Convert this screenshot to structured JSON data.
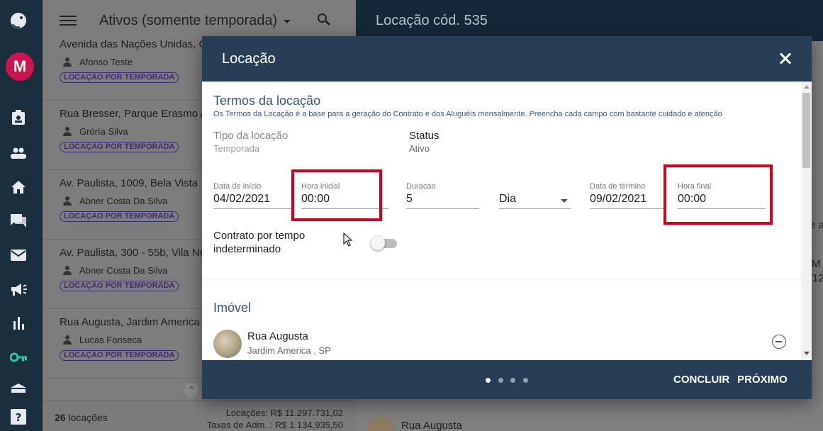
{
  "list": {
    "title": "Ativos (somente temporada)",
    "items": [
      {
        "address": "Avenida das Nações Unidas, C",
        "person": "Afonso Teste",
        "badge": "LOCAÇÃO POR TEMPORADA"
      },
      {
        "address": "Rua Bresser, Parque Erasmo A",
        "person": "Gróría Silva",
        "badge": "LOCAÇÃO POR TEMPORADA"
      },
      {
        "address": "Av. Paulista, 1009, Bela Vista",
        "person": "Abner Costa Da Silva",
        "badge": "LOCAÇÃO POR TEMPORADA"
      },
      {
        "address": "Av. Paulista, 300 - 55b, Vila No",
        "person": "Abner Costa Da Silva",
        "badge": "LOCAÇÃO POR TEMPORADA"
      },
      {
        "address": "Rua Augusta, Jardim America",
        "person": "Lucas Fonseca",
        "badge": "LOCAÇÃO POR TEMPORADA"
      }
    ],
    "footer": {
      "count_number": "26",
      "count_label": "locações",
      "locacoes_label": "Locações:",
      "locacoes_value": "R$ 11.297.731,02",
      "taxas_label": "Taxas de Adm. :",
      "taxas_value": "R$ 1.134.935,50"
    }
  },
  "user": {
    "initial": "M"
  },
  "detail": {
    "title": "Locação cód. 535",
    "peek_address": "Rua Augusta",
    "fragments": {
      "a": "e a",
      "m": "M",
      "date": "/12"
    }
  },
  "modal": {
    "title": "Locação",
    "section_terms": {
      "title": "Termos da locação",
      "description": "Os Termos da Locação é a base para a geração do Contrato e dos Aluguéis mensalmente. Preencha cada campo com bastante cuidado e atenção"
    },
    "tipo": {
      "label": "Tipo da locação",
      "value": "Temporada"
    },
    "status": {
      "label": "Status",
      "value": "Ativo"
    },
    "fields": {
      "data_inicio": {
        "label": "Data de início",
        "value": "04/02/2021"
      },
      "hora_inicial": {
        "label": "Hora inicial",
        "value": "00:00"
      },
      "duracao": {
        "label": "Duracao",
        "value": "5"
      },
      "unidade": {
        "value": "Dia"
      },
      "data_termino": {
        "label": "Data de término",
        "value": "09/02/2021"
      },
      "hora_final": {
        "label": "Hora final",
        "value": "00:00"
      }
    },
    "toggle": {
      "label_line1": "Contrato por tempo",
      "label_line2": "indeterminado",
      "on": false
    },
    "section_imovel": {
      "title": "Imóvel",
      "name": "Rua Augusta",
      "sub": "Jardim America , SP"
    },
    "pager": {
      "total": 4,
      "active": 1
    },
    "buttons": {
      "concluir": "CONCLUIR",
      "proximo": "PRÓXIMO"
    }
  },
  "colors": {
    "rail": "#1b2e3d",
    "modal_header": "#263e56",
    "highlight": "#d0021b",
    "badge": "#3c2b74",
    "avatar": "#c8174f"
  }
}
